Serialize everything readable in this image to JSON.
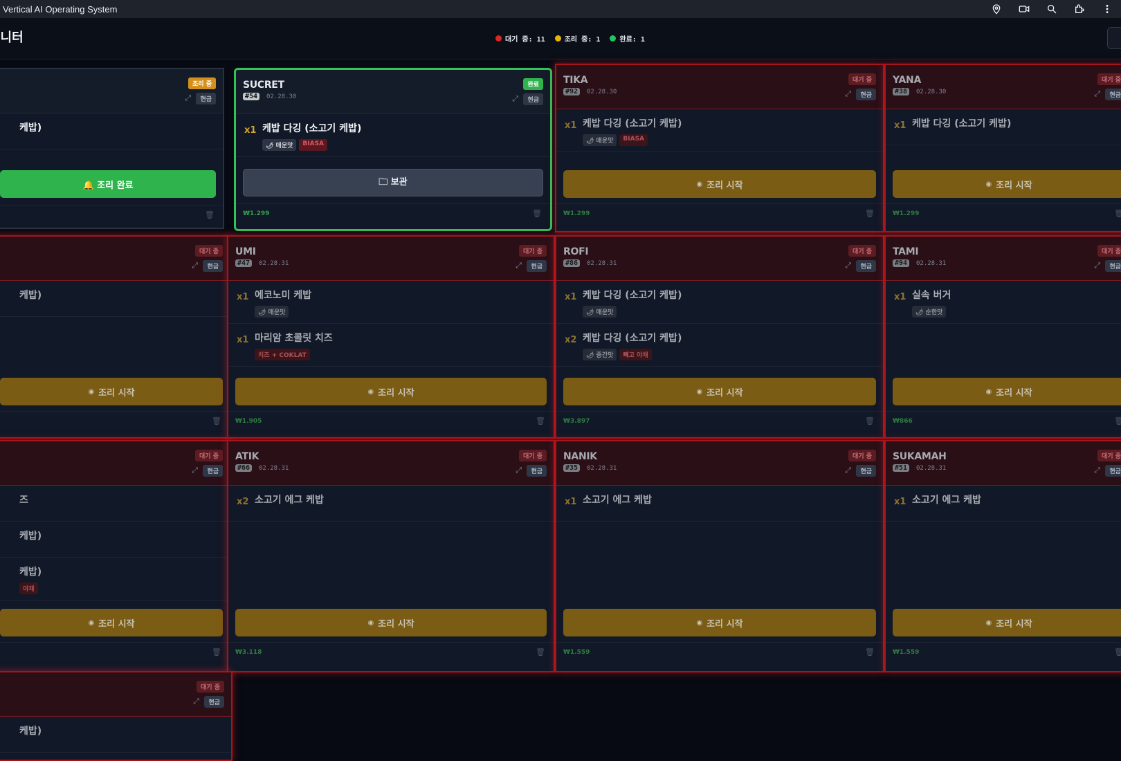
{
  "app": {
    "title": "Vertical AI Operating System"
  },
  "titlebar_icons": [
    "location-icon",
    "video-icon",
    "zoom-icon",
    "extension-icon",
    "more-icon"
  ],
  "header": {
    "title": "모니터",
    "legend": [
      {
        "label": "대기 중: 11",
        "color": "#dc2626"
      },
      {
        "label": "조리 중: 1",
        "color": "#eab308"
      },
      {
        "label": "완료: 1",
        "color": "#22c55e"
      }
    ]
  },
  "colors": {
    "waiting": "#a5151c",
    "cooking": "#d4901b",
    "done": "#2fb34c"
  },
  "orders": [
    {
      "id": "cooking-1",
      "name": "",
      "number": "",
      "time": "",
      "status": "조리 중",
      "payment": "현금",
      "items": [
        {
          "qty": "",
          "name": "케밥)",
          "tags": []
        }
      ],
      "button": "🔔 조리 완료",
      "price": ""
    },
    {
      "id": "sucret",
      "name": "SUCRET",
      "number": "#54",
      "time": "02.28.30",
      "status": "완료",
      "payment": "현금",
      "items": [
        {
          "qty": "x1",
          "name": "케밥 다깅 (소고기 케밥)",
          "tags": [
            {
              "text": "🌶 매운맛",
              "kind": "gray"
            },
            {
              "text": "BIASA",
              "kind": "red"
            }
          ]
        }
      ],
      "button": "🗀 보관",
      "price": "₩1.299"
    },
    {
      "id": "tika",
      "name": "TIKA",
      "number": "#92",
      "time": "02.28.30",
      "status": "대기 중",
      "payment": "현금",
      "items": [
        {
          "qty": "x1",
          "name": "케밥 다깅 (소고기 케밥)",
          "tags": [
            {
              "text": "🌶 매운맛",
              "kind": "gray"
            },
            {
              "text": "BIASA",
              "kind": "red"
            }
          ]
        }
      ],
      "button": "조리 시작",
      "price": "₩1.299"
    },
    {
      "id": "yana",
      "name": "YANA",
      "number": "#38",
      "time": "02.28.30",
      "status": "대기 중",
      "payment": "현금",
      "items": [
        {
          "qty": "x1",
          "name": "케밥 다깅 (소고기 케밥)",
          "tags": []
        }
      ],
      "button": "조리 시작",
      "price": "₩1.299"
    },
    {
      "id": "row2-left",
      "name": "",
      "number": "",
      "time": "",
      "status": "대기 중",
      "payment": "현금",
      "items": [
        {
          "qty": "",
          "name": "케밥)",
          "tags": []
        }
      ],
      "button": "조리 시작",
      "price": ""
    },
    {
      "id": "umi",
      "name": "UMI",
      "number": "#47",
      "time": "02.28.31",
      "status": "대기 중",
      "payment": "현금",
      "items": [
        {
          "qty": "x1",
          "name": "에코노미 케밥",
          "tags": [
            {
              "text": "🌶 매운맛",
              "kind": "gray"
            }
          ]
        },
        {
          "qty": "x1",
          "name": "마리암 초콜릿 치즈",
          "tags": [
            {
              "text": "치즈 + COKLAT",
              "kind": "red"
            }
          ]
        }
      ],
      "button": "조리 시작",
      "price": "₩1.905"
    },
    {
      "id": "rofi",
      "name": "ROFI",
      "number": "#86",
      "time": "02.28.31",
      "status": "대기 중",
      "payment": "현금",
      "items": [
        {
          "qty": "x1",
          "name": "케밥 다깅 (소고기 케밥)",
          "tags": [
            {
              "text": "🌶 매운맛",
              "kind": "gray"
            }
          ]
        },
        {
          "qty": "x2",
          "name": "케밥 다깅 (소고기 케밥)",
          "tags": [
            {
              "text": "🌶 중간맛",
              "kind": "gray"
            },
            {
              "text": "빼고 야채",
              "kind": "red"
            }
          ]
        }
      ],
      "button": "조리 시작",
      "price": "₩3.897"
    },
    {
      "id": "tami",
      "name": "TAMI",
      "number": "#94",
      "time": "02.28.31",
      "status": "대기 중",
      "payment": "현금",
      "items": [
        {
          "qty": "x1",
          "name": "실속 버거",
          "tags": [
            {
              "text": "🌶 순한맛",
              "kind": "gray"
            }
          ]
        }
      ],
      "button": "조리 시작",
      "price": "₩866"
    },
    {
      "id": "row3-left",
      "name": "",
      "number": "",
      "time": "",
      "status": "대기 중",
      "payment": "현금",
      "items": [
        {
          "qty": "",
          "name": "즈",
          "tags": []
        },
        {
          "qty": "",
          "name": "케밥)",
          "tags": []
        },
        {
          "qty": "",
          "name": "케밥)",
          "tags": [
            {
              "text": "야채",
              "kind": "red"
            }
          ]
        }
      ],
      "button": "조리 시작",
      "price": ""
    },
    {
      "id": "atik",
      "name": "ATIK",
      "number": "#66",
      "time": "02.28.31",
      "status": "대기 중",
      "payment": "현금",
      "items": [
        {
          "qty": "x2",
          "name": "소고기 에그 케밥",
          "tags": []
        }
      ],
      "button": "조리 시작",
      "price": "₩3.118"
    },
    {
      "id": "nanik",
      "name": "NANIK",
      "number": "#35",
      "time": "02.28.31",
      "status": "대기 중",
      "payment": "현금",
      "items": [
        {
          "qty": "x1",
          "name": "소고기 에그 케밥",
          "tags": []
        }
      ],
      "button": "조리 시작",
      "price": "₩1.559"
    },
    {
      "id": "sukamah",
      "name": "SUKAMAH",
      "number": "#51",
      "time": "02.28.31",
      "status": "대기 중",
      "payment": "현금",
      "items": [
        {
          "qty": "x1",
          "name": "소고기 에그 케밥",
          "tags": []
        }
      ],
      "button": "조리 시작",
      "price": "₩1.559"
    },
    {
      "id": "row4-left",
      "name": "",
      "number": "",
      "time": "",
      "status": "대기 중",
      "payment": "현금",
      "items": [
        {
          "qty": "",
          "name": "케밥)",
          "tags": []
        }
      ],
      "button": "",
      "price": ""
    }
  ]
}
